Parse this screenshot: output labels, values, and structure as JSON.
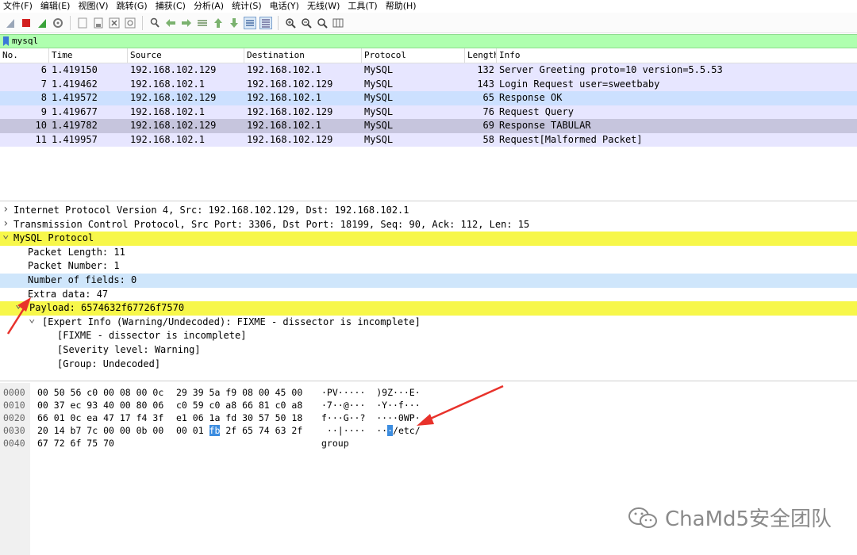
{
  "menu": [
    "文件(F)",
    "编辑(E)",
    "视图(V)",
    "跳转(G)",
    "捕获(C)",
    "分析(A)",
    "统计(S)",
    "电话(Y)",
    "无线(W)",
    "工具(T)",
    "帮助(H)"
  ],
  "toolbar_icons": [
    "shark-fin-start-icon",
    "stop-capture-icon",
    "restart-capture-icon",
    "capture-options-icon",
    "open-file-icon",
    "save-file-icon",
    "close-file-icon",
    "reload-file-icon",
    "find-packet-icon",
    "go-back-icon",
    "go-forward-icon",
    "go-to-packet-icon",
    "go-first-icon",
    "go-last-icon",
    "auto-scroll-icon",
    "colorize-icon",
    "zoom-in-icon",
    "zoom-out-icon",
    "zoom-normal-icon",
    "resize-columns-icon"
  ],
  "filter": {
    "value": "mysql"
  },
  "packet_list": {
    "headers": {
      "no": "No.",
      "time": "Time",
      "source": "Source",
      "destination": "Destination",
      "protocol": "Protocol",
      "length": "Length",
      "info": "Info"
    },
    "rows": [
      {
        "no": "6",
        "time": "1.419150",
        "source": "192.168.102.129",
        "destination": "192.168.102.1",
        "protocol": "MySQL",
        "length": "132",
        "info": "Server Greeting proto=10 version=5.5.53",
        "bg": "#e7e6ff"
      },
      {
        "no": "7",
        "time": "1.419462",
        "source": "192.168.102.1",
        "destination": "192.168.102.129",
        "protocol": "MySQL",
        "length": "143",
        "info": "Login Request user=sweetbaby",
        "bg": "#e7e6ff"
      },
      {
        "no": "8",
        "time": "1.419572",
        "source": "192.168.102.129",
        "destination": "192.168.102.1",
        "protocol": "MySQL",
        "length": "65",
        "info": "Response OK",
        "bg": "#cce0ff"
      },
      {
        "no": "9",
        "time": "1.419677",
        "source": "192.168.102.1",
        "destination": "192.168.102.129",
        "protocol": "MySQL",
        "length": "76",
        "info": "Request Query",
        "bg": "#e7e6ff"
      },
      {
        "no": "10",
        "time": "1.419782",
        "source": "192.168.102.129",
        "destination": "192.168.102.1",
        "protocol": "MySQL",
        "length": "69",
        "info": "Response TABULAR",
        "bg": "#c6c5dd"
      },
      {
        "no": "11",
        "time": "1.419957",
        "source": "192.168.102.1",
        "destination": "192.168.102.129",
        "protocol": "MySQL",
        "length": "58",
        "info": "Request[Malformed Packet]",
        "bg": "#e7e6ff"
      }
    ]
  },
  "detail": [
    {
      "text": "Internet Protocol Version 4, Src: 192.168.102.129, Dst: 192.168.102.1",
      "chevron": ">",
      "bg": "#ffffff"
    },
    {
      "text": "Transmission Control Protocol, Src Port: 3306, Dst Port: 18199, Seq: 90, Ack: 112, Len: 15",
      "chevron": ">",
      "bg": "#ffffff"
    },
    {
      "text": "MySQL Protocol",
      "chevron": "v",
      "bg": "#f7f74a"
    },
    {
      "text": "Packet Length: 11",
      "chevron": "",
      "bg": "#ffffff"
    },
    {
      "text": "Packet Number: 1",
      "chevron": "",
      "bg": "#ffffff"
    },
    {
      "text": "Number of fields: 0",
      "chevron": "",
      "bg": "#cfe6fb"
    },
    {
      "text": "Extra data: 47",
      "chevron": "",
      "bg": "#ffffff"
    },
    {
      "text": "Payload: 6574632f67726f7570",
      "chevron": "v",
      "bg": "#f7f74a"
    },
    {
      "text": "[Expert Info (Warning/Undecoded): FIXME - dissector is incomplete]",
      "chevron": "v",
      "bg": "#ffffff"
    },
    {
      "text": "[FIXME - dissector is incomplete]",
      "chevron": "",
      "bg": "#ffffff"
    },
    {
      "text": "[Severity level: Warning]",
      "chevron": "",
      "bg": "#ffffff"
    },
    {
      "text": "[Group: Undecoded]",
      "chevron": "",
      "bg": "#ffffff"
    }
  ],
  "hex_dump": [
    {
      "offset": "0000",
      "bytes_a": "00 50 56 c0 00 08 00 0c",
      "bytes_b": "29 39 5a f9 08 00 45 00",
      "ascii": "·PV·····  )9Z···E·"
    },
    {
      "offset": "0010",
      "bytes_a": "00 37 ec 93 40 00 80 06",
      "bytes_b": "c0 59 c0 a8 66 81 c0 a8",
      "ascii": "·7··@···  ·Y··f···"
    },
    {
      "offset": "0020",
      "bytes_a": "66 01 0c ea 47 17 f4 3f",
      "bytes_b": "e1 06 1a fd 30 57 50 18",
      "ascii": "f···G··?  ····0WP·"
    },
    {
      "offset": "0030",
      "bytes_a": "20 14 b7 7c 00 00 0b 00",
      "bytes_b_pre": "00 01 ",
      "bytes_b_sel": "fb",
      "bytes_b_post": " 2f 65 74 63 2f",
      "ascii_pre": " ··|····  ··",
      "ascii_sel": "·",
      "ascii_post": "/etc/"
    },
    {
      "offset": "0040",
      "bytes_a": "67 72 6f 75 70",
      "bytes_b": "",
      "ascii": "group"
    }
  ],
  "watermark": "ChaMd5安全团队",
  "colors": {
    "filter_bg": "#afffaf",
    "highlight_yellow": "#f7f74a",
    "selection_blue": "#cfe6fb",
    "hex_select": "#3c8de0",
    "arrow_red": "#e8322b"
  }
}
